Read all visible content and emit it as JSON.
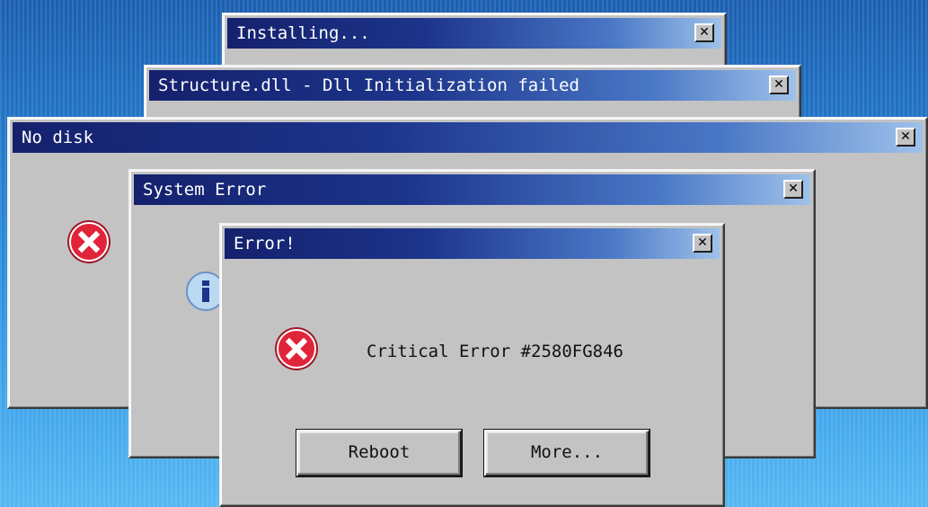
{
  "windows": {
    "installing": {
      "title": "Installing...",
      "close": "✕"
    },
    "structure": {
      "title": "Structure.dll - Dll Initialization failed",
      "close": "✕"
    },
    "no_disk": {
      "title": "No disk",
      "close": "✕"
    },
    "system_error": {
      "title": "System Error",
      "close": "✕"
    },
    "error": {
      "title": "Error!",
      "close": "✕",
      "message": "Critical Error #2580FG846",
      "buttons": {
        "reboot": "Reboot",
        "more": "More..."
      }
    }
  },
  "icons": {
    "error": "error-icon",
    "info": "info-icon"
  },
  "colors": {
    "titlebar_dark": "#15216d",
    "titlebar_light": "#9fc2ea",
    "window_face": "#c3c3c3",
    "error_red": "#e0243a"
  }
}
